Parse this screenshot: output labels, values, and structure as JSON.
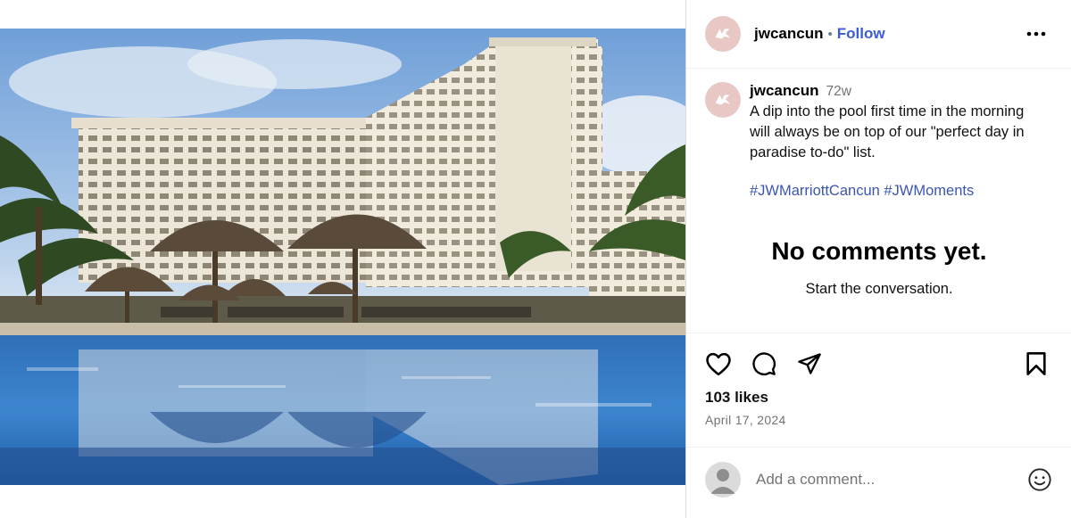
{
  "post": {
    "username": "jwcancun",
    "follow_label": "Follow",
    "separator": "•",
    "avatar_icon": "marriott-logo-icon",
    "more_icon": "more-options-icon"
  },
  "caption": {
    "username": "jwcancun",
    "time_ago": "72w",
    "text": "A dip into the pool first time in the morning will always be on top of our \"perfect day in paradise to-do\" list.",
    "hashtags": "#JWMarriottCancun #JWMoments"
  },
  "comments": {
    "empty_title": "No comments yet.",
    "empty_subtitle": "Start the conversation."
  },
  "actions": {
    "icons": [
      "heart-icon",
      "comment-icon",
      "share-icon",
      "bookmark-icon"
    ],
    "likes": "103 likes",
    "date": "April 17, 2024"
  },
  "composer": {
    "placeholder": "Add a comment...",
    "emoji_icon": "emoji-icon"
  },
  "colors": {
    "link_blue": "#3b5bdb",
    "hashtag_blue": "#3b56b0",
    "muted_text": "#737373",
    "avatar_bg": "#e8c8c4"
  }
}
